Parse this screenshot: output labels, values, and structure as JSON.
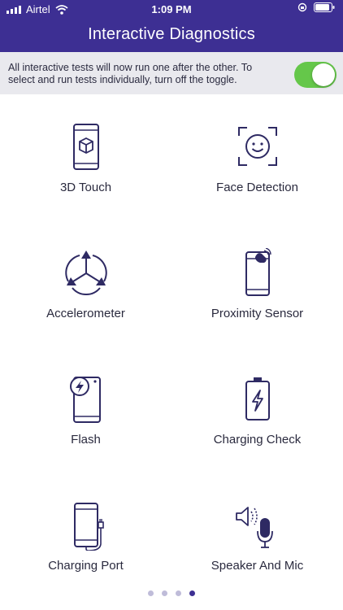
{
  "status_bar": {
    "carrier": "Airtel",
    "time": "1:09 PM"
  },
  "header": {
    "title": "Interactive Diagnostics"
  },
  "info": {
    "text": "All interactive tests will now run one after the other. To select and run tests individually, turn off the toggle.",
    "toggle_on": true
  },
  "tests": [
    {
      "label": "3D Touch",
      "icon": "phone-cube-icon"
    },
    {
      "label": "Face Detection",
      "icon": "face-scan-icon"
    },
    {
      "label": "Accelerometer",
      "icon": "accelerometer-icon"
    },
    {
      "label": "Proximity Sensor",
      "icon": "proximity-phone-icon"
    },
    {
      "label": "Flash",
      "icon": "flash-phone-icon"
    },
    {
      "label": "Charging Check",
      "icon": "battery-charging-icon"
    },
    {
      "label": "Charging Port",
      "icon": "charging-port-icon"
    },
    {
      "label": "Speaker And Mic",
      "icon": "speaker-mic-icon"
    }
  ],
  "pager": {
    "pages": 4,
    "current": 4
  },
  "colors": {
    "header": "#3d2f93",
    "toggle": "#65c74a",
    "info_bg": "#e9e9ee",
    "icon_stroke": "#2e2a63"
  }
}
